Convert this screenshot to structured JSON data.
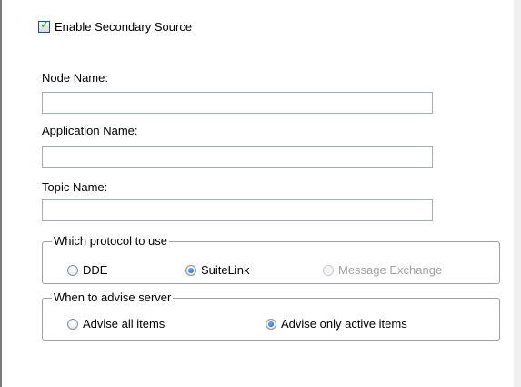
{
  "secondary_source": {
    "enable_label": "Enable Secondary Source",
    "enable_checked": true
  },
  "fields": {
    "node_name_label": "Node Name:",
    "node_name_value": "",
    "application_name_label": "Application Name:",
    "application_name_value": "",
    "topic_name_label": "Topic Name:",
    "topic_name_value": ""
  },
  "protocol_group": {
    "legend": "Which protocol to use",
    "options": [
      {
        "label": "DDE",
        "selected": false,
        "enabled": true
      },
      {
        "label": "SuiteLink",
        "selected": true,
        "enabled": true
      },
      {
        "label": "Message Exchange",
        "selected": false,
        "enabled": false
      }
    ]
  },
  "advise_group": {
    "legend": "When to advise server",
    "options": [
      {
        "label": "Advise all items",
        "selected": false,
        "enabled": true
      },
      {
        "label": "Advise only active items",
        "selected": true,
        "enabled": true
      }
    ]
  },
  "colors": {
    "checkmark": "#21a121",
    "radio_dot": "#1f5fb8",
    "disabled_text": "#a0a0a0"
  }
}
